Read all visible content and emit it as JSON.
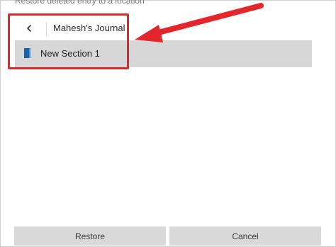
{
  "header": {
    "top_text": "Restore deleted entry to a location"
  },
  "nav": {
    "back_icon": "chevron-left-icon",
    "title": "Mahesh's Journal"
  },
  "sections": [
    {
      "label": "New Section 1",
      "icon": "section-tab-icon",
      "color": "#1f5fa6",
      "selected": true
    }
  ],
  "annotation": {
    "color": "#e3262a"
  },
  "buttons": {
    "restore_label": "Restore",
    "cancel_label": "Cancel"
  }
}
